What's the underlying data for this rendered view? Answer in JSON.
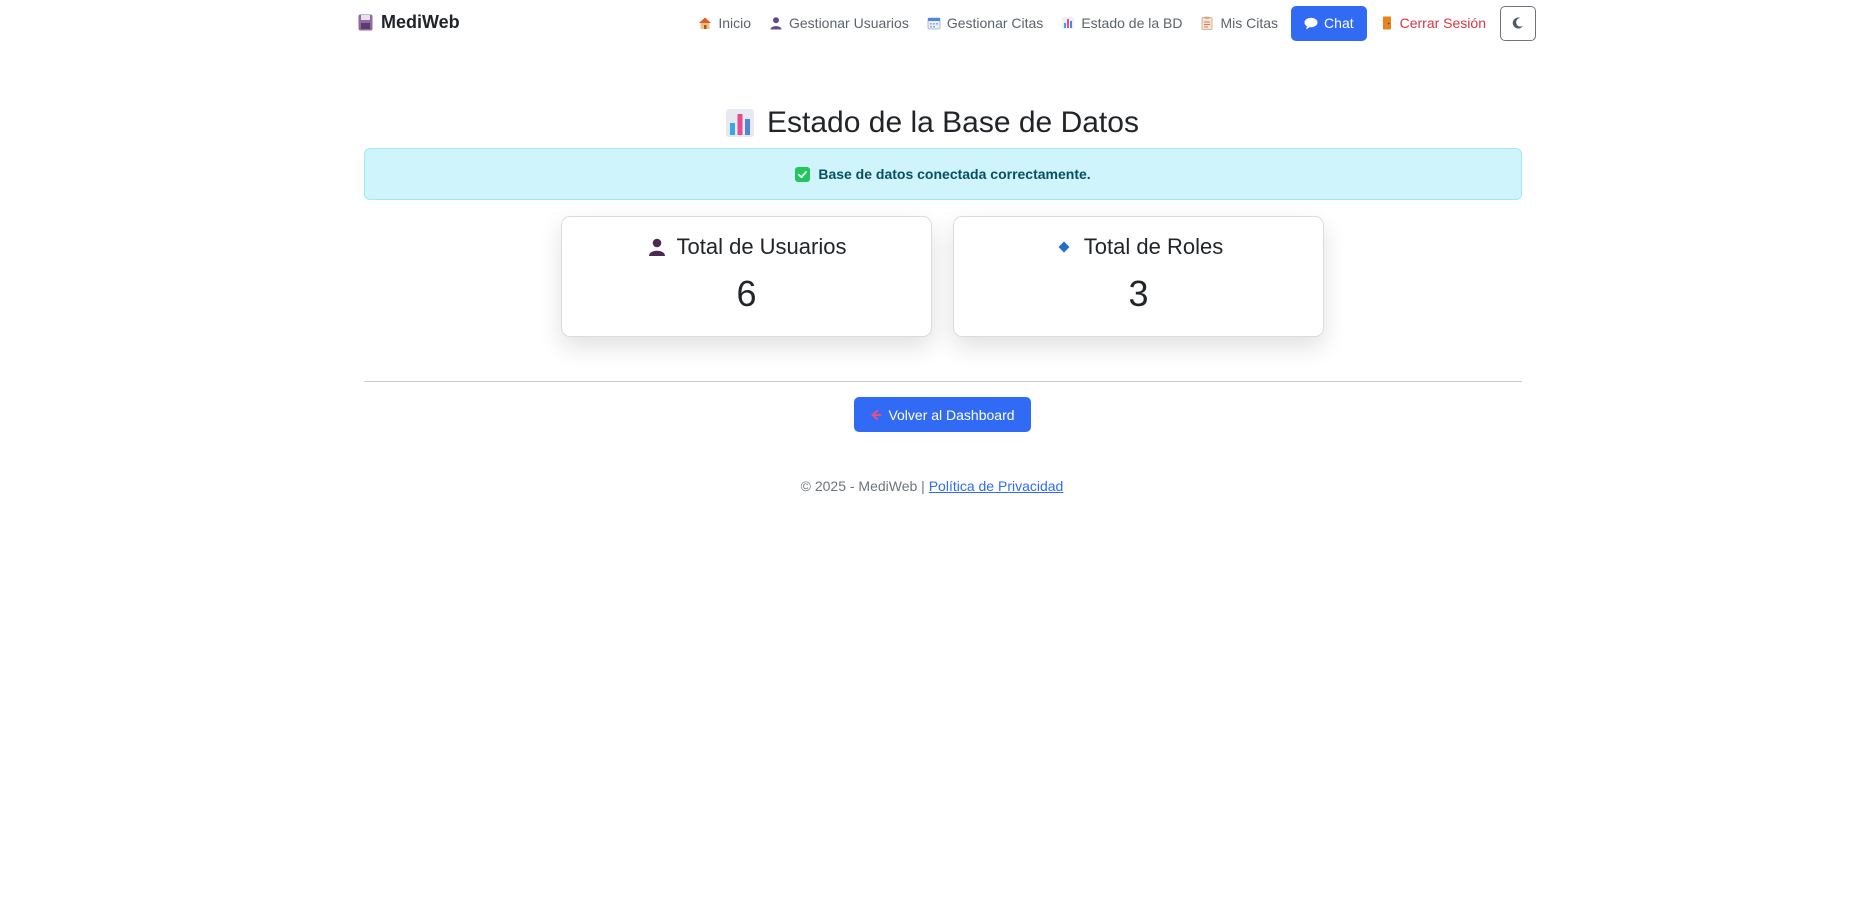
{
  "navbar": {
    "brand": "MediWeb",
    "items": [
      {
        "label": "Inicio",
        "icon": "house-icon"
      },
      {
        "label": "Gestionar Usuarios",
        "icon": "user-icon"
      },
      {
        "label": "Gestionar Citas",
        "icon": "calendar-icon"
      },
      {
        "label": "Estado de la BD",
        "icon": "bar-chart-icon"
      },
      {
        "label": "Mis Citas",
        "icon": "clipboard-icon"
      }
    ],
    "chat_label": "Chat",
    "logout_label": "Cerrar Sesión",
    "theme_toggle_icon": "moon-icon"
  },
  "main": {
    "title": "Estado de la Base de Datos",
    "alert": "Base de datos conectada correctamente.",
    "cards": [
      {
        "title": "Total de Usuarios",
        "value": "6",
        "icon": "user-icon"
      },
      {
        "title": "Total de Roles",
        "value": "3",
        "icon": "diamond-icon"
      }
    ],
    "back_button": "Volver al Dashboard"
  },
  "footer": {
    "text": "© 2025 - MediWeb |",
    "link": "Política de Privacidad"
  },
  "colors": {
    "primary": "#316bf5",
    "alert_bg": "#cff4fc",
    "alert_text": "#055160",
    "danger": "#dc3545"
  }
}
